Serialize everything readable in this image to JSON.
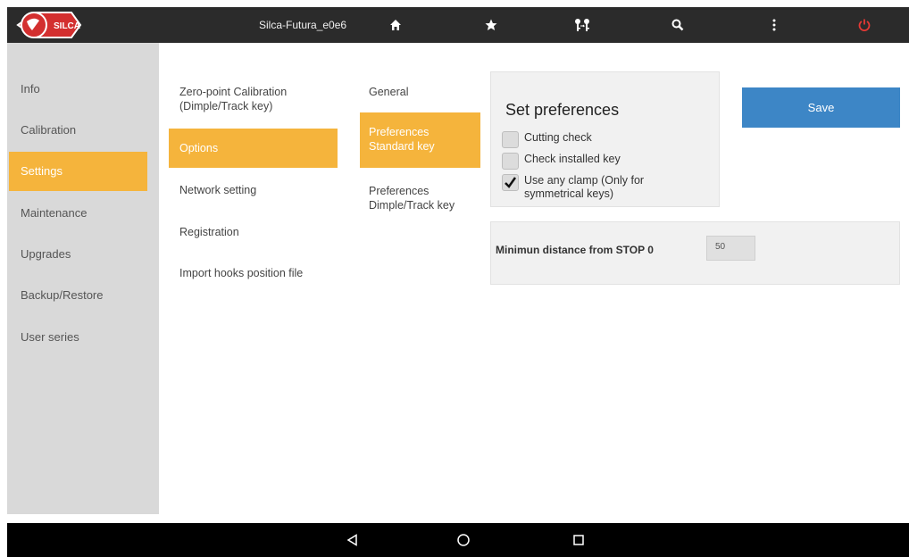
{
  "topbar": {
    "logo_text": "SILCA",
    "device_name": "Silca-Futura_e0e6",
    "icons": [
      "home-icon",
      "star-icon",
      "keys-icon",
      "search-icon",
      "more-vertical-icon",
      "power-icon"
    ],
    "power_color": "#e53935"
  },
  "sidebar": {
    "items": [
      {
        "label": "Info"
      },
      {
        "label": "Calibration"
      },
      {
        "label": "Settings"
      },
      {
        "label": "Maintenance"
      },
      {
        "label": "Upgrades"
      },
      {
        "label": "Backup/Restore"
      },
      {
        "label": "User series"
      }
    ],
    "active_index": 2
  },
  "column1": {
    "items": [
      {
        "label": "Zero-point Calibration (Dimple/Track key)"
      },
      {
        "label": "Options"
      },
      {
        "label": "Network setting"
      },
      {
        "label": "Registration"
      },
      {
        "label": "Import hooks position file"
      }
    ],
    "active_index": 1
  },
  "column2": {
    "items": [
      {
        "label": "General"
      },
      {
        "label": "Preferences Standard key"
      },
      {
        "label": "Preferences Dimple/Track key"
      }
    ],
    "active_index": 1
  },
  "preferences": {
    "title": "Set preferences",
    "options": [
      {
        "label": "Cutting check",
        "checked": false
      },
      {
        "label": "Check installed key",
        "checked": false
      },
      {
        "label": "Use any clamp (Only for symmetrical keys)",
        "checked": true
      }
    ]
  },
  "save_button": {
    "label": "Save"
  },
  "distance": {
    "label": "Minimun distance from STOP 0",
    "value": "50"
  },
  "colors": {
    "accent": "#f5b43c",
    "primary_button": "#3d86c6",
    "topbar": "#2b2b2b"
  },
  "navbar": {
    "icons": [
      "back-icon",
      "home-circle-icon",
      "recents-icon"
    ]
  }
}
